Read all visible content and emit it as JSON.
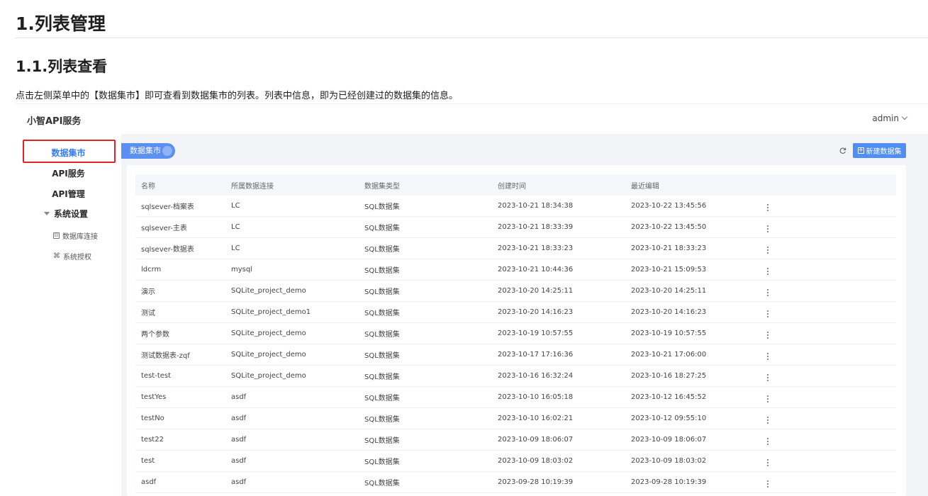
{
  "doc": {
    "h1": "1.列表管理",
    "h2": "1.1.列表查看",
    "paragraph": "点击左侧菜单中的【数据集市】即可查看到数据集市的列表。列表中信息，即为已经创建过的数据集的信息。"
  },
  "app": {
    "brand": "小智API服务",
    "user": "admin",
    "colors": {
      "accent": "#4f8ef3",
      "highlight": "#e02424"
    }
  },
  "sidebar": {
    "items": [
      {
        "label": "数据集市",
        "active": true
      },
      {
        "label": "API服务"
      },
      {
        "label": "API管理"
      }
    ],
    "group": {
      "label": "系统设置",
      "icon": "caret-down-icon"
    },
    "subitems": [
      {
        "label": "数据库连接",
        "icon": "database-icon"
      },
      {
        "label": "系统授权",
        "icon": "command-icon"
      }
    ]
  },
  "content": {
    "tab": "数据集市",
    "refresh_icon": "refresh-icon",
    "new_button": "新建数据集"
  },
  "table": {
    "headers": [
      "名称",
      "所属数据连接",
      "数据集类型",
      "创建时间",
      "最近编辑"
    ],
    "rows": [
      [
        "sqlsever-档案表",
        "LC",
        "SQL数据集",
        "2023-10-21 18:34:38",
        "2023-10-22 13:45:56"
      ],
      [
        "sqlsever-主表",
        "LC",
        "SQL数据集",
        "2023-10-21 18:33:39",
        "2023-10-22 13:45:50"
      ],
      [
        "sqlsever-数据表",
        "LC",
        "SQL数据集",
        "2023-10-21 18:33:23",
        "2023-10-21 18:33:23"
      ],
      [
        "ldcrm",
        "mysql",
        "SQL数据集",
        "2023-10-21 10:44:36",
        "2023-10-21 15:09:53"
      ],
      [
        "演示",
        "SQLite_project_demo",
        "SQL数据集",
        "2023-10-20 14:25:11",
        "2023-10-20 14:25:11"
      ],
      [
        "测试",
        "SQLite_project_demo1",
        "SQL数据集",
        "2023-10-20 14:16:23",
        "2023-10-20 14:16:23"
      ],
      [
        "两个参数",
        "SQLite_project_demo",
        "SQL数据集",
        "2023-10-19 10:57:55",
        "2023-10-19 10:57:55"
      ],
      [
        "测试数据表-zqf",
        "SQLite_project_demo",
        "SQL数据集",
        "2023-10-17 17:16:36",
        "2023-10-21 17:06:00"
      ],
      [
        "test-test",
        "SQLite_project_demo",
        "SQL数据集",
        "2023-10-16 16:32:24",
        "2023-10-16 18:27:25"
      ],
      [
        "testYes",
        "asdf",
        "SQL数据集",
        "2023-10-10 16:05:18",
        "2023-10-12 16:45:52"
      ],
      [
        "testNo",
        "asdf",
        "SQL数据集",
        "2023-10-10 16:02:21",
        "2023-10-12 09:55:10"
      ],
      [
        "test22",
        "asdf",
        "SQL数据集",
        "2023-10-09 18:06:07",
        "2023-10-09 18:06:07"
      ],
      [
        "test",
        "asdf",
        "SQL数据集",
        "2023-10-09 18:03:02",
        "2023-10-09 18:03:02"
      ],
      [
        "asdf",
        "asdf",
        "SQL数据集",
        "2023-09-28 10:19:39",
        "2023-09-28 10:19:39"
      ]
    ]
  }
}
